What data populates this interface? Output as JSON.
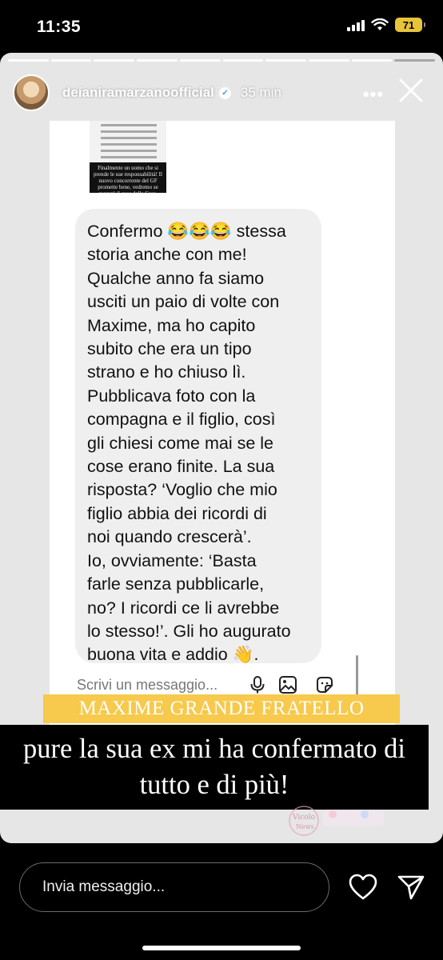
{
  "status_bar": {
    "time": "11:35",
    "battery": "71",
    "battery_color": "#e8c43a"
  },
  "story": {
    "username": "deianiramarzanoofficial",
    "posted": "35 min",
    "verified": true,
    "progress_segments": 10,
    "progress_done": 9
  },
  "screenshot": {
    "message": "Confermo 😂😂😂 stessa\nstoria anche con me!\nQualche anno fa siamo\nusciti un paio di volte con\nMaxime, ma ho capito\nsubito che era un tipo\nstrano e ho chiuso lì.\nPubblicava foto con la\ncompagna e il figlio, così\ngli chiesi come mai se le\ncose erano finite. La sua\nrisposta? ‘Voglio che mio\nfiglio abbia dei ricordi di\nnoi quando crescerà’.\nIo, ovviamente: ‘Basta\nfarle senza pubblicarle,\nno? I ricordi ce li avrebbe\nlo stesso!’. Gli ho augurato\nbuona vita e addio 👋.",
    "composer_placeholder": "Scrivi un messaggio...",
    "thumbnail_text": "Finalmente un uomo che si prende le sue responsabilità! Il nuovo concorrente del GF promette bene, vedremo se reggerà il caos della Casa."
  },
  "captions": {
    "yellow": "MAXIME GRANDE FRATELLO",
    "yellow_color": "#f7c94c",
    "black": "pure la sua ex mi ha confermato di tutto e di più!"
  },
  "bottom_bar": {
    "reply_placeholder": "Invia messaggio..."
  },
  "icons": [
    "signal-icon",
    "wifi-icon",
    "battery-icon",
    "verified-icon",
    "more-icon",
    "close-icon",
    "microphone-icon",
    "image-icon",
    "sticker-icon",
    "heart-icon",
    "send-icon"
  ]
}
